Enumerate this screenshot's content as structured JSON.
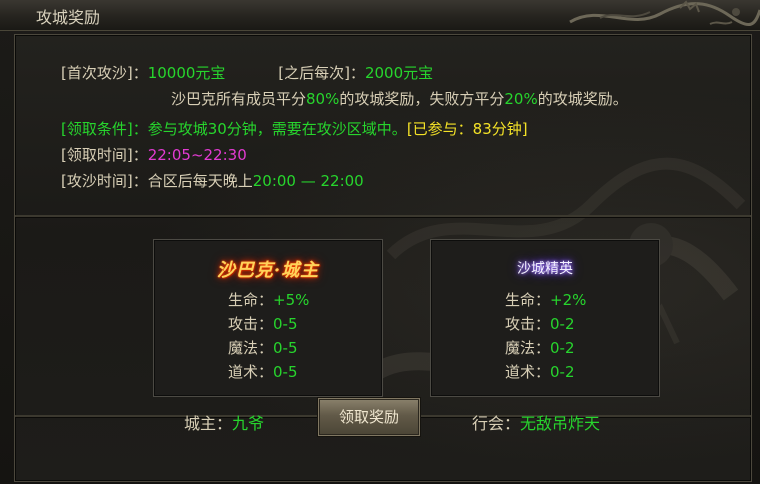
{
  "window": {
    "title": "攻城奖励"
  },
  "info": {
    "first_label": "[首次攻沙]：",
    "first_value": "10000元宝",
    "after_label": "[之后每次]：",
    "after_value": "2000元宝",
    "split": {
      "p1": "沙巴克所有成员平分",
      "pct1": "80%",
      "p2": "的攻城奖励，失败方平分",
      "pct2": "20%",
      "p3": "的攻城奖励。"
    },
    "condition_label": "[领取条件]：",
    "condition_value": "参与攻城30分钟，需要在攻沙区域中。",
    "participated": "[已参与：83分钟]",
    "claim_time_label": "[领取时间]：",
    "claim_time_value": "22:05~22:30",
    "siege_time_label": "[攻沙时间]：",
    "siege_time_prefix": "合区后每天晚上",
    "siege_time_value": "20:00 — 22:00"
  },
  "panels": [
    {
      "title": "沙巴克·城主",
      "stats": [
        {
          "key": "生命：",
          "value": "+5%"
        },
        {
          "key": "攻击：",
          "value": "0-5"
        },
        {
          "key": "魔法：",
          "value": "0-5"
        },
        {
          "key": "道术：",
          "value": "0-5"
        }
      ]
    },
    {
      "title": "沙城精英",
      "stats": [
        {
          "key": "生命：",
          "value": "+2%"
        },
        {
          "key": "攻击：",
          "value": "0-2"
        },
        {
          "key": "魔法：",
          "value": "0-2"
        },
        {
          "key": "道术：",
          "value": "0-2"
        }
      ]
    }
  ],
  "footer": {
    "lord_label": "城主：",
    "lord_name": "九爷",
    "claim_button": "领取奖励",
    "guild_label": "行会：",
    "guild_name": "无敌吊炸天"
  },
  "colors": {
    "green": "#27d52d",
    "yellow": "#f4e227",
    "magenta": "#e23bd2",
    "label": "#d8cfb6"
  },
  "icons": [
    "dragon-ornament-icon",
    "dragon-background-icon"
  ]
}
